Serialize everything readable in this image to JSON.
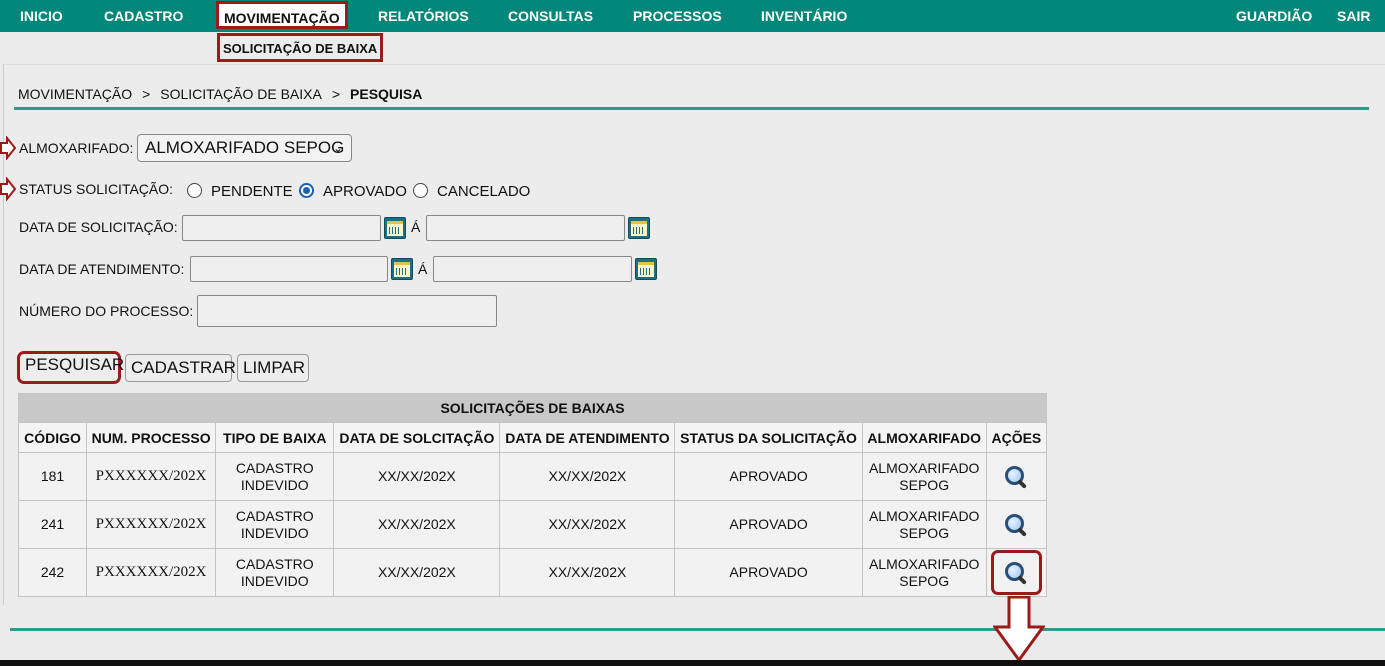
{
  "nav": {
    "items": [
      "INICIO",
      "CADASTRO",
      "MOVIMENTAÇÃO",
      "RELATÓRIOS",
      "CONSULTAS",
      "PROCESSOS",
      "INVENTÁRIO"
    ],
    "right": [
      "GUARDIÃO",
      "SAIR"
    ],
    "active": "MOVIMENTAÇÃO"
  },
  "subnav": {
    "item": "SOLICITAÇÃO DE BAIXA"
  },
  "breadcrumb": {
    "level1": "MOVIMENTAÇÃO",
    "level2": "SOLICITAÇÃO DE BAIXA",
    "current": "PESQUISA",
    "sep": ">"
  },
  "form": {
    "almoxarifado_label": "ALMOXARIFADO:",
    "almoxarifado_value": "ALMOXARIFADO SEPOG",
    "status_label": "STATUS SOLICITAÇÃO:",
    "status_options": [
      "PENDENTE",
      "APROVADO",
      "CANCELADO"
    ],
    "status_selected": "APROVADO",
    "data_solicitacao_label": "DATA DE SOLICITAÇÃO:",
    "data_atendimento_label": "DATA DE ATENDIMENTO:",
    "range_sep": "Á",
    "numero_processo_label": "NÚMERO DO PROCESSO:",
    "data_solicitacao_from": "",
    "data_solicitacao_to": "",
    "data_atendimento_from": "",
    "data_atendimento_to": "",
    "numero_processo": ""
  },
  "buttons": {
    "pesquisar": "PESQUISAR",
    "cadastrar": "CADASTRAR",
    "limpar": "LIMPAR"
  },
  "table": {
    "caption": "SOLICITAÇÕES DE BAIXAS",
    "columns": [
      "CÓDIGO",
      "NUM. PROCESSO",
      "TIPO DE BAIXA",
      "DATA DE SOLCITAÇÃO",
      "DATA DE ATENDIMENTO",
      "STATUS DA SOLICITAÇÃO",
      "ALMOXARIFADO",
      "AÇÕES"
    ],
    "rows": [
      {
        "codigo": "181",
        "processo": "PXXXXXX/202X",
        "tipo_l1": "CADASTRO",
        "tipo_l2": "INDEVIDO",
        "data_sol": "XX/XX/202X",
        "data_at": "XX/XX/202X",
        "status": "APROVADO",
        "alm_l1": "ALMOXARIFADO",
        "alm_l2": "SEPOG",
        "acao_icon": "magnifier-icon"
      },
      {
        "codigo": "241",
        "processo": "PXXXXXX/202X",
        "tipo_l1": "CADASTRO",
        "tipo_l2": "INDEVIDO",
        "data_sol": "XX/XX/202X",
        "data_at": "XX/XX/202X",
        "status": "APROVADO",
        "alm_l1": "ALMOXARIFADO",
        "alm_l2": "SEPOG",
        "acao_icon": "magnifier-icon"
      },
      {
        "codigo": "242",
        "processo": "PXXXXXX/202X",
        "tipo_l1": "CADASTRO",
        "tipo_l2": "INDEVIDO",
        "data_sol": "XX/XX/202X",
        "data_at": "XX/XX/202X",
        "status": "APROVADO",
        "alm_l1": "ALMOXARIFADO",
        "alm_l2": "SEPOG",
        "acao_icon": "magnifier-icon"
      }
    ]
  },
  "colors": {
    "nav_bg": "#00877a",
    "accent_rule": "#2a9b8e",
    "highlight": "#9b1b1b",
    "radio": "#1a5fb4"
  }
}
